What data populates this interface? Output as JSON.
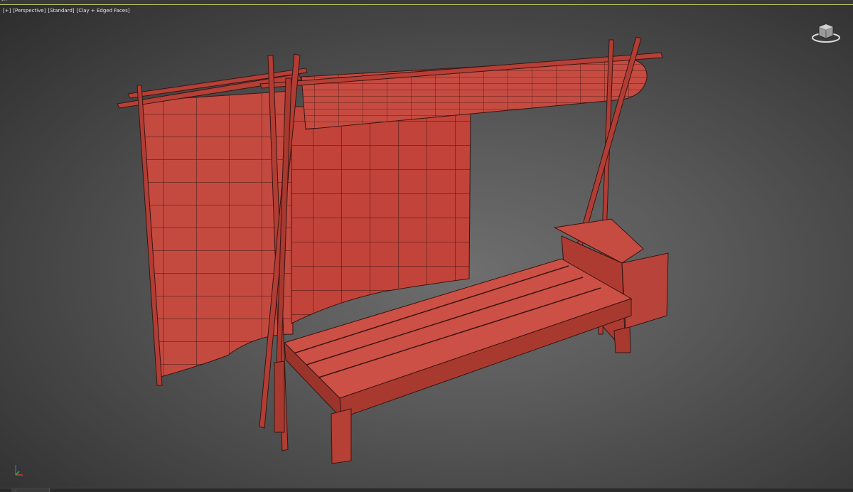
{
  "window": {
    "title": "..."
  },
  "viewport": {
    "labels": [
      "[+]",
      "[Perspective]",
      "[Standard]",
      "[Clay + Edged Faces]"
    ]
  },
  "icons": {
    "viewcube": "viewcube-icon",
    "axis": "axis-tripod-icon"
  },
  "statusbar": {
    "tab": "..."
  },
  "colors": {
    "clay": "#c9473e",
    "clay_dark": "#8e2b25",
    "wire": "#3a1512",
    "bg": "#5a5a5a"
  }
}
